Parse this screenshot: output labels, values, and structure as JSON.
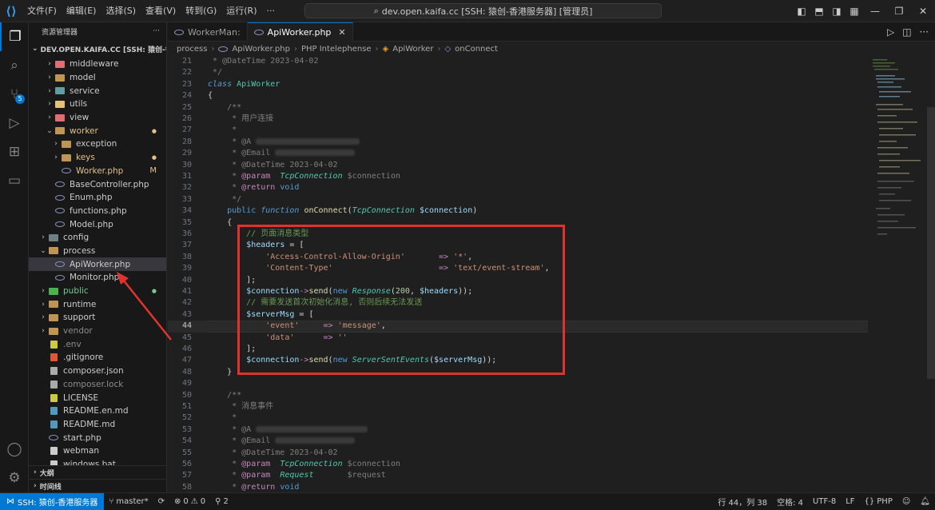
{
  "titlebar": {
    "menu": [
      "文件(F)",
      "编辑(E)",
      "选择(S)",
      "查看(V)",
      "转到(G)",
      "运行(R)",
      "···"
    ],
    "command_center": "dev.open.kaifa.cc [SSH: 猿创-香港服务器] [管理员]"
  },
  "sidebar": {
    "title": "资源管理器",
    "more": "···",
    "workspace": "DEV.OPEN.KAIFA.CC [SSH: 猿创-香港服...",
    "items": [
      {
        "label": "middleware",
        "depth": 1,
        "type": "folder",
        "chev": "›",
        "icon_color": "#e06c75"
      },
      {
        "label": "model",
        "depth": 1,
        "type": "folder",
        "chev": "›",
        "icon_color": "#c09553"
      },
      {
        "label": "service",
        "depth": 1,
        "type": "folder",
        "chev": "›",
        "icon_color": "#5f9ea0"
      },
      {
        "label": "utils",
        "depth": 1,
        "type": "folder",
        "chev": "›",
        "icon_color": "#e5c07b"
      },
      {
        "label": "view",
        "depth": 1,
        "type": "folder",
        "chev": "›",
        "icon_color": "#e06c75"
      },
      {
        "label": "worker",
        "depth": 1,
        "type": "folder",
        "chev": "⌄",
        "icon_color": "#c09553",
        "color": "#e2c08d",
        "mark": "●"
      },
      {
        "label": "exception",
        "depth": 2,
        "type": "folder",
        "chev": "›",
        "icon_color": "#c09553"
      },
      {
        "label": "keys",
        "depth": 2,
        "type": "folder",
        "chev": "›",
        "icon_color": "#c09553",
        "color": "#e2c08d",
        "mark": "●"
      },
      {
        "label": "Worker.php",
        "depth": 2,
        "type": "php",
        "chev": "",
        "color": "#e2c08d",
        "mark": "M"
      },
      {
        "label": "BaseController.php",
        "depth": 1,
        "type": "php",
        "chev": ""
      },
      {
        "label": "Enum.php",
        "depth": 1,
        "type": "php",
        "chev": ""
      },
      {
        "label": "functions.php",
        "depth": 1,
        "type": "php",
        "chev": ""
      },
      {
        "label": "Model.php",
        "depth": 1,
        "type": "php",
        "chev": ""
      },
      {
        "label": "config",
        "depth": 0,
        "type": "folder",
        "chev": "›",
        "icon_color": "#6d8086"
      },
      {
        "label": "process",
        "depth": 0,
        "type": "folder",
        "chev": "⌄",
        "icon_color": "#c09553"
      },
      {
        "label": "ApiWorker.php",
        "depth": 1,
        "type": "php",
        "chev": "",
        "selected": true
      },
      {
        "label": "Monitor.php",
        "depth": 1,
        "type": "php",
        "chev": ""
      },
      {
        "label": "public",
        "depth": 0,
        "type": "folder",
        "chev": "›",
        "icon_color": "#4caf50",
        "color": "#73c991",
        "mark": "●"
      },
      {
        "label": "runtime",
        "depth": 0,
        "type": "folder",
        "chev": "›",
        "icon_color": "#c09553"
      },
      {
        "label": "support",
        "depth": 0,
        "type": "folder",
        "chev": "›",
        "icon_color": "#c09553"
      },
      {
        "label": "vendor",
        "depth": 0,
        "type": "folder",
        "chev": "›",
        "icon_color": "#c09553",
        "color": "#8c8c8c"
      },
      {
        "label": ".env",
        "depth": 0,
        "type": "file",
        "chev": "",
        "color": "#8c8c8c",
        "icon_color": "#cbcb41"
      },
      {
        "label": ".gitignore",
        "depth": 0,
        "type": "file",
        "chev": "",
        "icon_color": "#e05735"
      },
      {
        "label": "composer.json",
        "depth": 0,
        "type": "file",
        "chev": "",
        "icon_color": "#aaaaaa"
      },
      {
        "label": "composer.lock",
        "depth": 0,
        "type": "file",
        "chev": "",
        "color": "#8c8c8c",
        "icon_color": "#aaaaaa"
      },
      {
        "label": "LICENSE",
        "depth": 0,
        "type": "file",
        "chev": "",
        "icon_color": "#cbcb41"
      },
      {
        "label": "README.en.md",
        "depth": 0,
        "type": "file",
        "chev": "",
        "icon_color": "#519aba"
      },
      {
        "label": "README.md",
        "depth": 0,
        "type": "file",
        "chev": "",
        "icon_color": "#519aba"
      },
      {
        "label": "start.php",
        "depth": 0,
        "type": "php",
        "chev": ""
      },
      {
        "label": "webman",
        "depth": 0,
        "type": "file",
        "chev": "",
        "icon_color": "#cccccc"
      },
      {
        "label": "windows.bat",
        "depth": 0,
        "type": "file",
        "chev": "",
        "icon_color": "#cccccc"
      }
    ],
    "outline": [
      "大纲",
      "时间线"
    ]
  },
  "tabs": [
    {
      "label": "WorkerMan:",
      "active": false
    },
    {
      "label": "ApiWorker.php",
      "active": true,
      "close": "✕"
    }
  ],
  "breadcrumb": [
    "process",
    "ApiWorker.php",
    "PHP Intelephense",
    "ApiWorker",
    "onConnect"
  ],
  "statusbar": {
    "remote": "SSH: 猿创-香港服务器",
    "branch": "master*",
    "errors": "0",
    "warnings": "0",
    "ports": "2",
    "position": "行 44，列 38",
    "spaces": "空格: 4",
    "encoding": "UTF-8",
    "eol": "LF",
    "language": "PHP"
  },
  "colors": {
    "accent": "#0078d4",
    "annotation_red": "#e0332f"
  }
}
